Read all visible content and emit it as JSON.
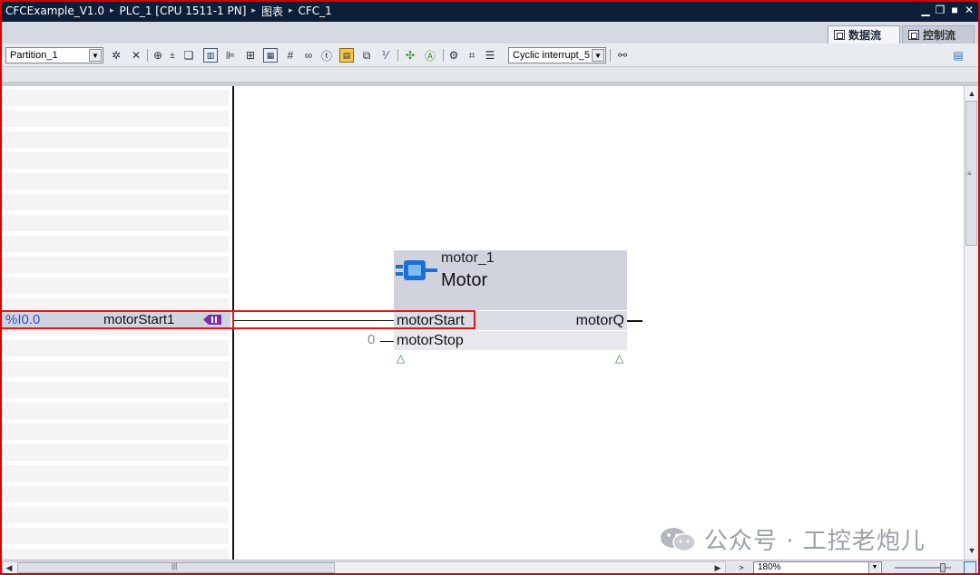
{
  "titlebar": {
    "breadcrumbs": [
      "CFCExample_V1.0",
      "PLC_1 [CPU 1511-1 PN]",
      "图表",
      "CFC_1"
    ],
    "separator": "▸"
  },
  "view_tabs": [
    {
      "label": "数据流",
      "active": true
    },
    {
      "label": "控制流",
      "active": false
    }
  ],
  "toolbar": {
    "partition_value": "Partition_1",
    "task_value": "Cyclic interrupt_5"
  },
  "interface": {
    "address": "%I0.0",
    "variable": "motorStart1"
  },
  "block": {
    "instance_name": "motor_1",
    "type_name": "Motor",
    "inputs": [
      "motorStart",
      "motorStop"
    ],
    "outputs": [
      "motorQ"
    ],
    "motorStop_value": "0"
  },
  "zoom": {
    "value": "180%"
  },
  "watermark": {
    "text": "公众号 · 工控老炮儿"
  },
  "colors": {
    "title_bg": "#0d1f38",
    "highlight": "#e01818",
    "address_text": "#3452c8",
    "block_header": "#d0d2de"
  }
}
